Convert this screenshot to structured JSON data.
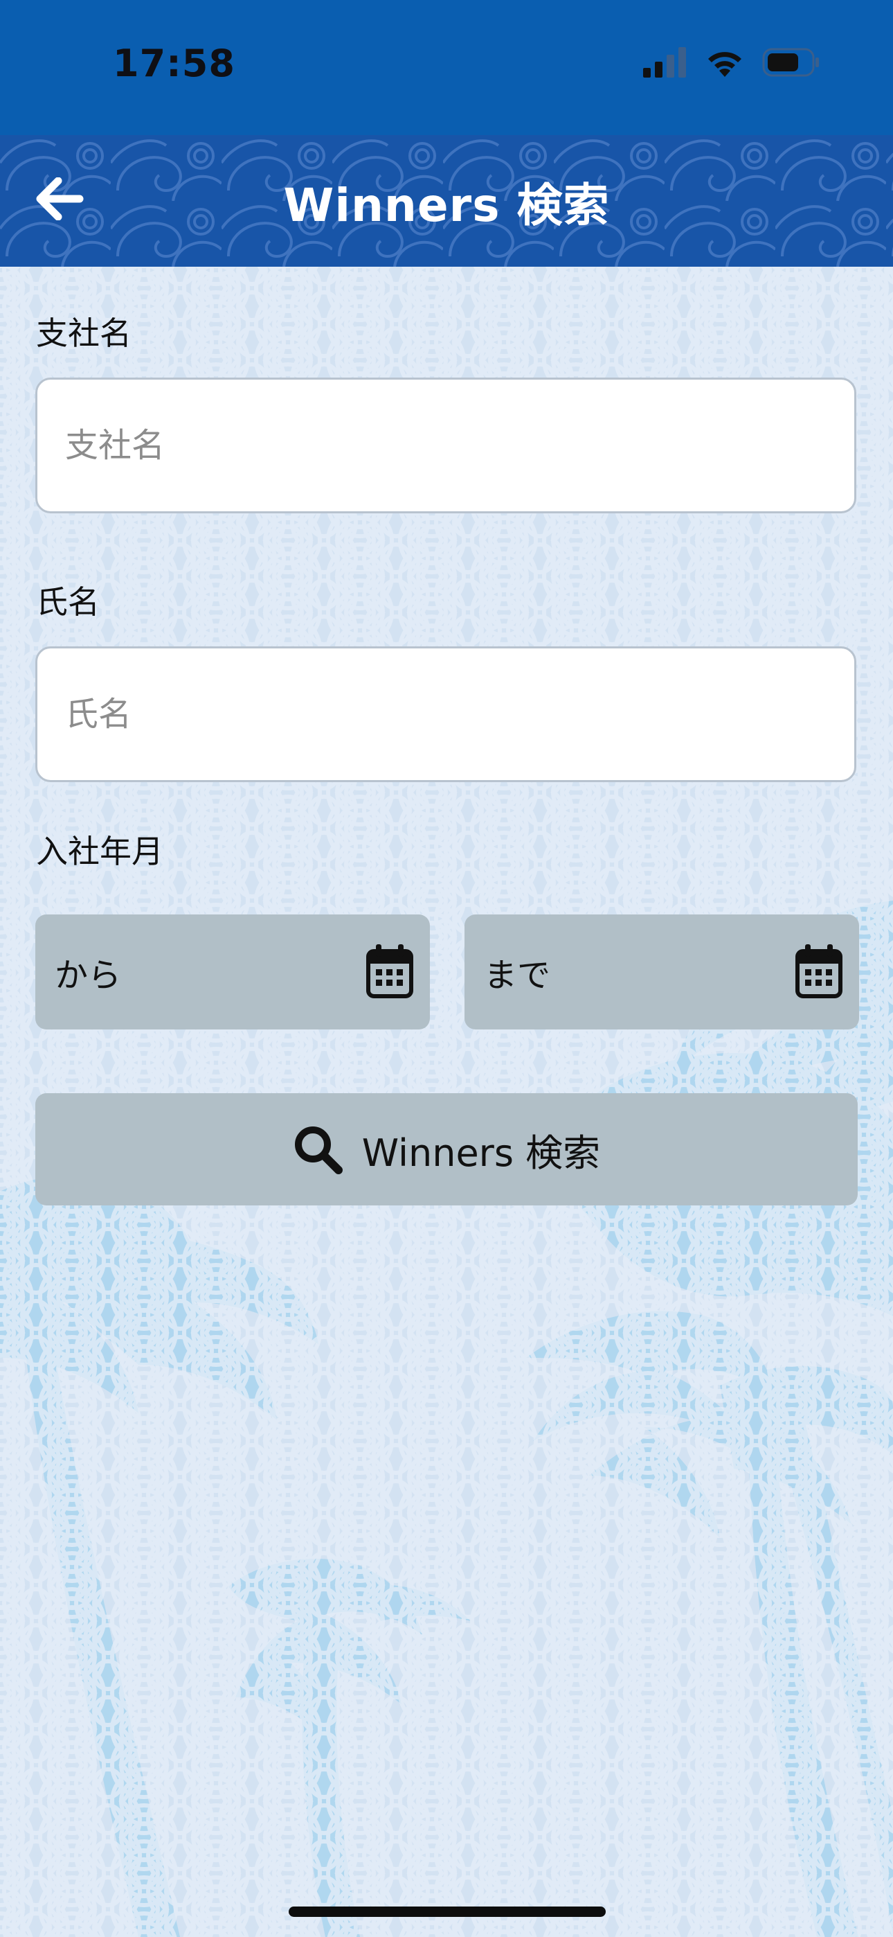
{
  "status_bar": {
    "time": "17:58",
    "icons": [
      "cellular-signal-icon",
      "wifi-icon",
      "battery-icon"
    ]
  },
  "nav": {
    "back_icon": "arrow-left-icon",
    "title": "Winners 検索"
  },
  "form": {
    "branch": {
      "label": "支社名",
      "placeholder": "支社名",
      "value": ""
    },
    "name": {
      "label": "氏名",
      "placeholder": "氏名",
      "value": ""
    },
    "join_date": {
      "label": "入社年月",
      "from_text": "から",
      "to_text": "まで",
      "icon": "calendar-icon"
    },
    "search_button": {
      "icon": "search-icon",
      "label": "Winners 検索"
    }
  },
  "colors": {
    "status_bar": "#0a5eb0",
    "nav_bar": "#1855a8",
    "page_background": "#d5e3f2",
    "button_gray": "#b1bfc7",
    "palm_silhouette": "#a9d5ef"
  }
}
